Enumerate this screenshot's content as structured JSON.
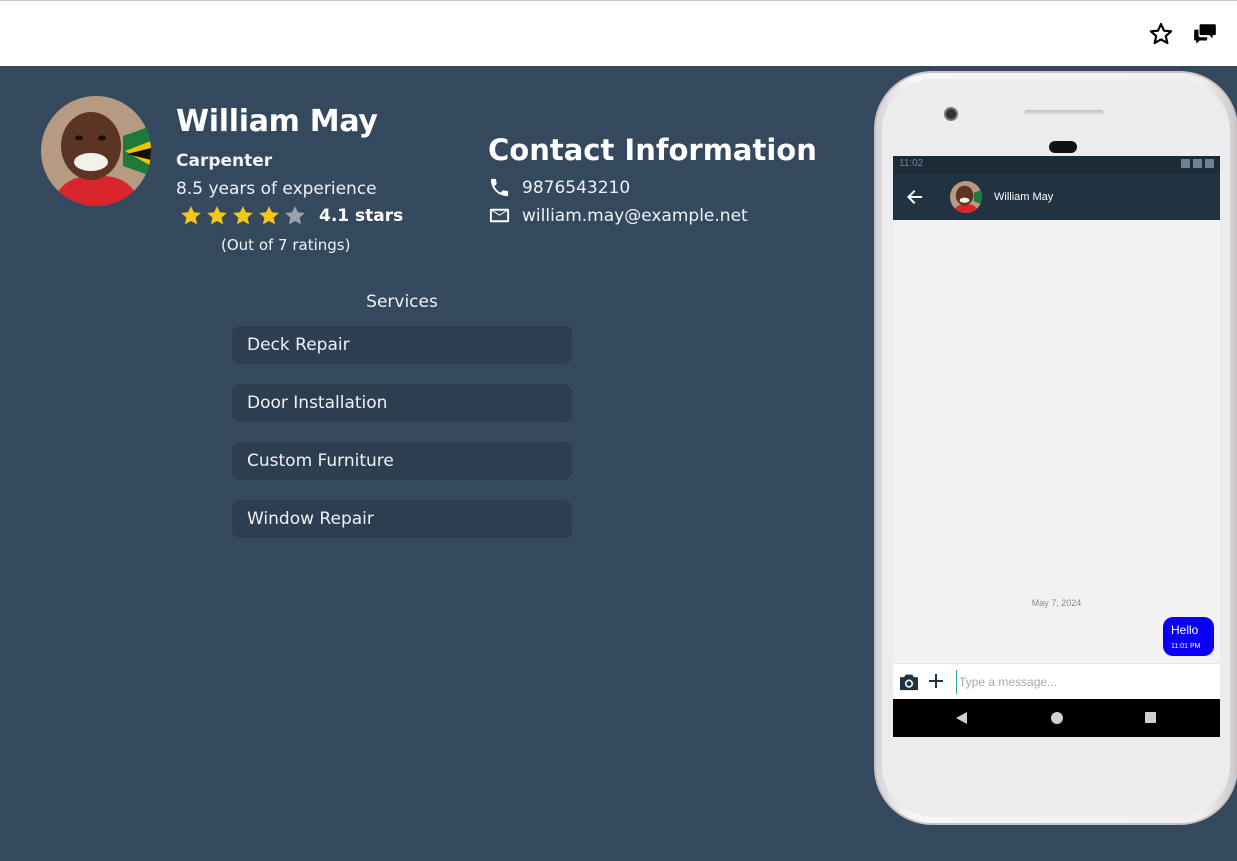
{
  "header": {
    "favorite_icon": "star-outline-icon",
    "chat_icon": "chat-bubbles-icon"
  },
  "profile": {
    "name": "William May",
    "profession": "Carpenter",
    "experience": "8.5 years of experience",
    "rating_value": 4.1,
    "rating_text": "4.1 stars",
    "ratings_count_text": "(Out of 7 ratings)",
    "stars_filled": 4,
    "stars_total": 5,
    "star_color": "#f5c518",
    "star_empty_color": "#9aa3ad"
  },
  "contact": {
    "title": "Contact Information",
    "phone": "9876543210",
    "email": "william.may@example.net"
  },
  "services": {
    "title": "Services",
    "items": [
      "Deck Repair",
      "Door Installation",
      "Custom Furniture",
      "Window Repair"
    ]
  },
  "chat": {
    "status_time": "11:02",
    "contact_name": "William May",
    "date_separator": "May 7, 2024",
    "messages": [
      {
        "text": "Hello",
        "time": "11:01 PM",
        "outgoing": true
      }
    ],
    "input_placeholder": "Type a message...",
    "bubble_color": "#0b00f5"
  },
  "colors": {
    "page_bg": "#35495e",
    "service_bg": "#2e3e51",
    "chat_header_bg": "#213242"
  }
}
